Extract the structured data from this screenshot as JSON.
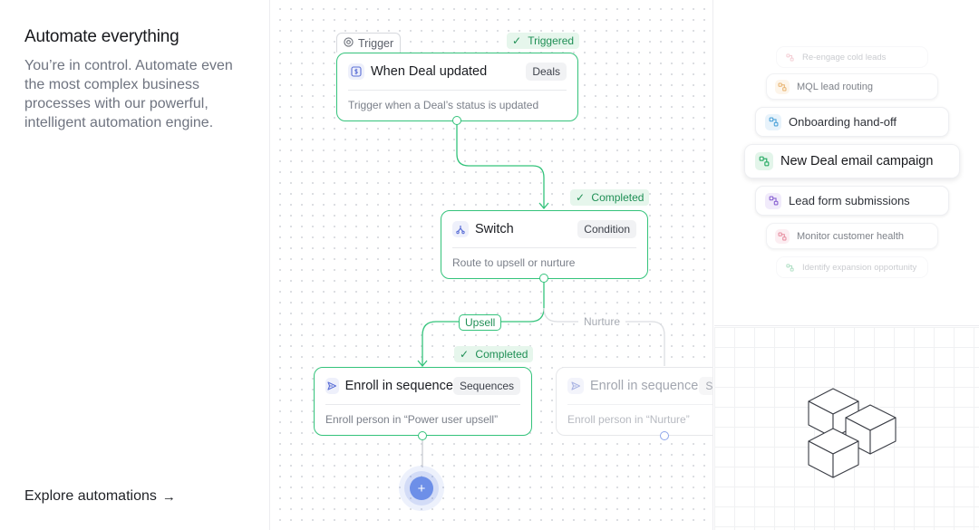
{
  "intro": {
    "title": "Automate everything",
    "description": "You’re in control. Automate even the most complex business processes with our powerful, intelligent automation engine.",
    "explore_label": "Explore automations",
    "explore_arrow": "→"
  },
  "workflow": {
    "trigger_tab": "Trigger",
    "nodes": [
      {
        "title": "When Deal updated",
        "tag": "Deals",
        "desc": "Trigger when a Deal’s status is updated",
        "status": "Triggered",
        "icon": "dollar-icon"
      },
      {
        "title": "Switch",
        "tag": "Condition",
        "desc": "Route to upsell or nurture",
        "status": "Completed",
        "icon": "switch-icon"
      },
      {
        "title": "Enroll in sequence",
        "tag": "Sequences",
        "desc": "Enroll person in “Power user upsell”",
        "status": "Completed",
        "icon": "send-icon"
      },
      {
        "title": "Enroll in sequence",
        "tag": "Se",
        "desc": "Enroll person in “Nurture”",
        "icon": "send-icon"
      }
    ],
    "branches": {
      "left": "Upsell",
      "right": "Nurture"
    },
    "check": "✓",
    "add_label": "+"
  },
  "automations": [
    {
      "label": "Re-engage cold leads",
      "color": "#e58a9b"
    },
    {
      "label": "MQL lead routing",
      "color": "#e3a04a"
    },
    {
      "label": "Onboarding hand-off",
      "color": "#4da3d9"
    },
    {
      "label": "New Deal email campaign",
      "color": "#2fae6a"
    },
    {
      "label": "Lead form submissions",
      "color": "#8a63d2"
    },
    {
      "label": "Monitor customer health",
      "color": "#e06f86"
    },
    {
      "label": "Identify expansion opportunity",
      "color": "#41b273"
    }
  ],
  "colors": {
    "accent_green": "#34c37b",
    "accent_blue": "#6d8fe8"
  }
}
